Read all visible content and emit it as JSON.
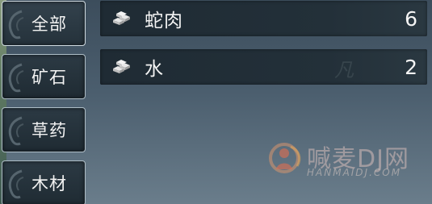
{
  "categories": [
    {
      "label": "全部",
      "active": true
    },
    {
      "label": "矿石",
      "active": false
    },
    {
      "label": "草药",
      "active": false
    },
    {
      "label": "木材",
      "active": false
    }
  ],
  "items": [
    {
      "name": "蛇肉",
      "count": "6",
      "icon": "ingot-stack-icon"
    },
    {
      "name": "水",
      "count": "2",
      "icon": "ingot-stack-icon"
    }
  ],
  "watermark": {
    "glyph": "凡",
    "site_name": "喊麦DJ网",
    "site_url": "HANMAIDJ.COM"
  },
  "colors": {
    "tab_border": "#aebdc6",
    "row_bg": "#1f2b34",
    "text": "#f4f4f4"
  }
}
